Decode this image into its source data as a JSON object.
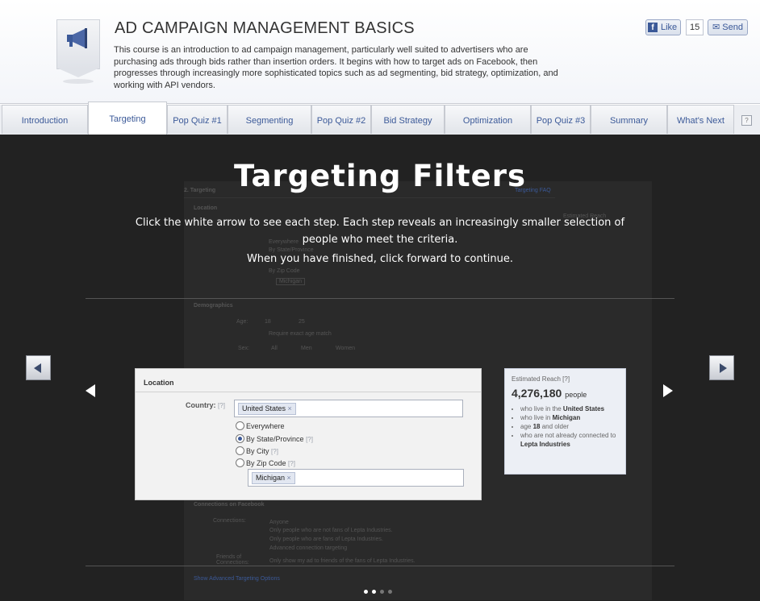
{
  "header": {
    "title": "AD CAMPAIGN MANAGEMENT BASICS",
    "description": "This course is an introduction to ad campaign management, particularly well suited to advertisers who are purchasing ads through bids rather than insertion orders. It begins with how to target ads on Facebook, then progresses through increasingly more sophisticated topics such as ad segmenting, bid strategy, optimization, and working with API vendors.",
    "icon": "megaphone-icon",
    "like_label": "Like",
    "like_count": "15",
    "send_label": "Send"
  },
  "tabs": [
    {
      "label": "Introduction"
    },
    {
      "label": "Targeting"
    },
    {
      "label": "Pop Quiz #1"
    },
    {
      "label": "Segmenting"
    },
    {
      "label": "Pop Quiz #2"
    },
    {
      "label": "Bid Strategy"
    },
    {
      "label": "Optimization"
    },
    {
      "label": "Pop Quiz #3"
    },
    {
      "label": "Summary"
    },
    {
      "label": "What's Next"
    }
  ],
  "help_label": "?",
  "active_tab": "Targeting",
  "slide": {
    "heading": "Targeting Filters",
    "instruction": "Click the white arrow to see each step. Each step reveals an increasingly smaller selection of people who meet the criteria.",
    "instruction2": "When you have finished, click forward to continue.",
    "background_labels": [
      "2. Targeting",
      "Targeting FAQ",
      "Location",
      "Everywhere",
      "By State/Province",
      "By Zip Code",
      "Michigan",
      "Demographics",
      "Age:",
      "18",
      "25",
      "Require exact age match",
      "Sex:",
      "All",
      "Men",
      "Women",
      "Connections on Facebook",
      "Connections:",
      "Anyone",
      "Only people who are not fans of Lepta Industries.",
      "Only people who are fans of Lepta Industries.",
      "Advanced connection targeting",
      "Friends of Connections:",
      "Only show my ad to friends of the fans of Lepta Industries.",
      "Show Advanced Targeting Options",
      "Estimated Reach"
    ],
    "panel": {
      "title": "Location",
      "country_label": "Country:",
      "help_mark": "[?]",
      "country_token": "United States",
      "options": [
        "Everywhere",
        "By State/Province",
        "By City",
        "By Zip Code"
      ],
      "selected_option": "By State/Province",
      "state_token": "Michigan"
    },
    "reach": {
      "label": "Estimated Reach",
      "help_mark": "[?]",
      "count": "4,276,180",
      "unit": "people",
      "criteria": [
        {
          "pre": "who live in the ",
          "bold": "United States",
          "post": ""
        },
        {
          "pre": "who live in ",
          "bold": "Michigan",
          "post": ""
        },
        {
          "pre": "age ",
          "bold": "18",
          "post": " and older"
        },
        {
          "pre": "who are not already connected to ",
          "bold": "Lepta Industries",
          "post": ""
        }
      ]
    },
    "step_index": 2,
    "step_count": 4
  }
}
